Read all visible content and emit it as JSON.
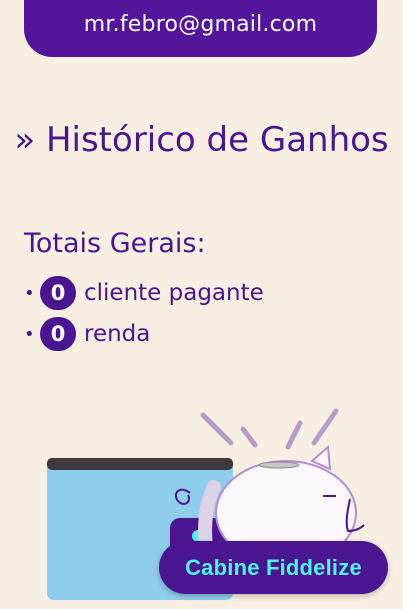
{
  "account": {
    "email": "mr.febro@gmail.com"
  },
  "page": {
    "title": "» Histórico de Ganhos"
  },
  "totals": {
    "heading": "Totais Gerais:",
    "items": [
      {
        "bullet": "•",
        "count": "0",
        "label": "cliente pagante"
      },
      {
        "bullet": "•",
        "count": "0",
        "label": "renda"
      }
    ]
  },
  "cta": {
    "label": "Cabine Fiddelize"
  },
  "colors": {
    "brand_purple": "#4a1590",
    "background": "#f7efe2",
    "cta_text": "#4ff5e8"
  }
}
